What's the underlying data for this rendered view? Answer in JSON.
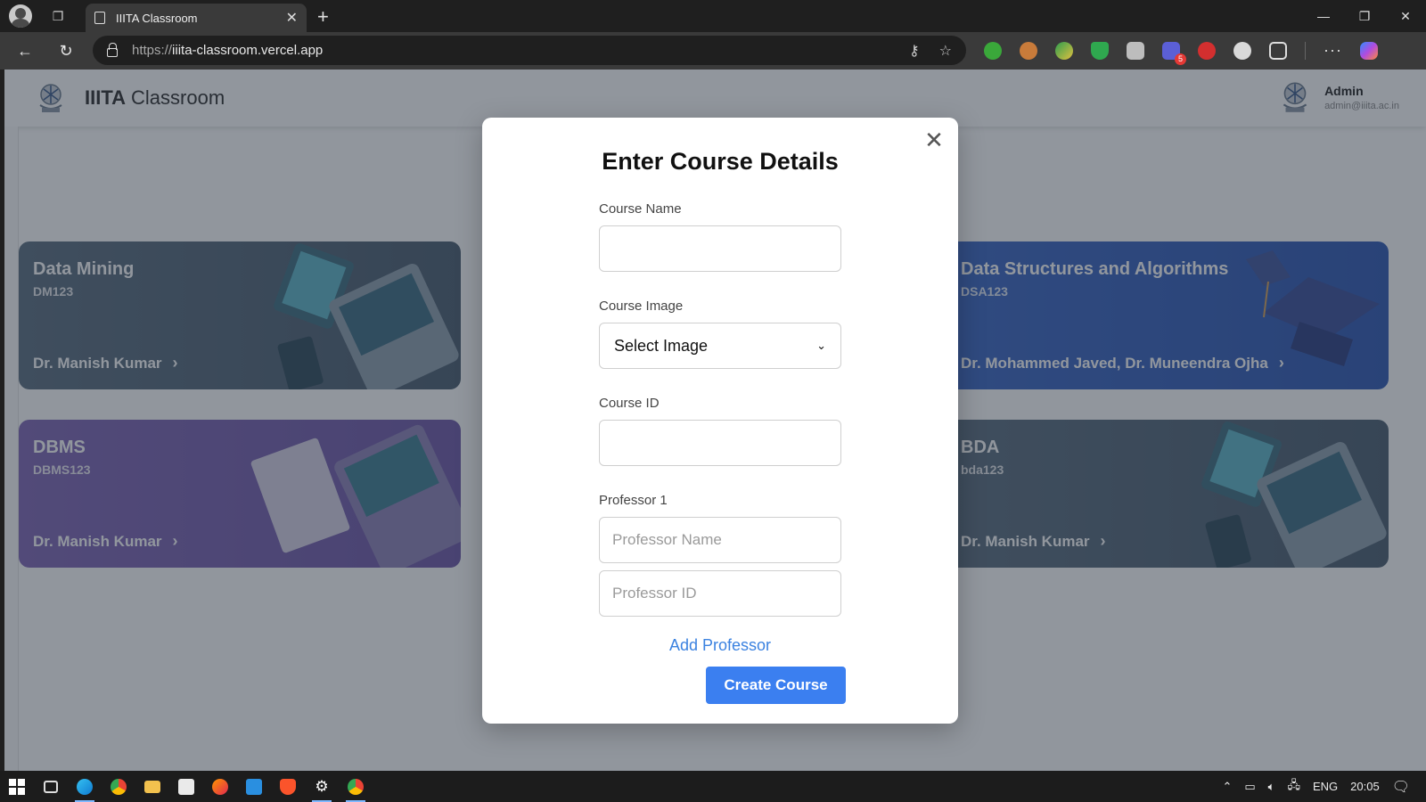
{
  "browser": {
    "tab_title": "IIITA Classroom",
    "url_proto": "https://",
    "url_host": "iiita-classroom.vercel.app",
    "extension_badge": "5"
  },
  "app": {
    "brand_bold": "IIITA",
    "brand_rest": "Classroom",
    "user_name": "Admin",
    "user_email": "admin@iiita.ac.in"
  },
  "courses": [
    {
      "name": "Data Mining",
      "code": "DM123",
      "professors": "Dr. Manish Kumar"
    },
    {
      "name": "Data Structures and Algorithms",
      "code": "DSA123",
      "professors": "Dr. Mohammed Javed, Dr. Muneendra Ojha"
    },
    {
      "name": "DBMS",
      "code": "DBMS123",
      "professors": "Dr. Manish Kumar"
    },
    {
      "name": "BDA",
      "code": "bda123",
      "professors": "Dr. Manish Kumar"
    }
  ],
  "modal": {
    "title": "Enter Course Details",
    "course_name_label": "Course Name",
    "course_name_value": "",
    "course_image_label": "Course Image",
    "course_image_selected": "Select Image",
    "course_id_label": "Course ID",
    "course_id_value": "",
    "professor_label": "Professor 1",
    "professor_name_placeholder": "Professor Name",
    "professor_id_placeholder": "Professor ID",
    "add_professor": "Add Professor",
    "create_button": "Create Course"
  },
  "taskbar": {
    "language": "ENG",
    "time": "20:05"
  }
}
